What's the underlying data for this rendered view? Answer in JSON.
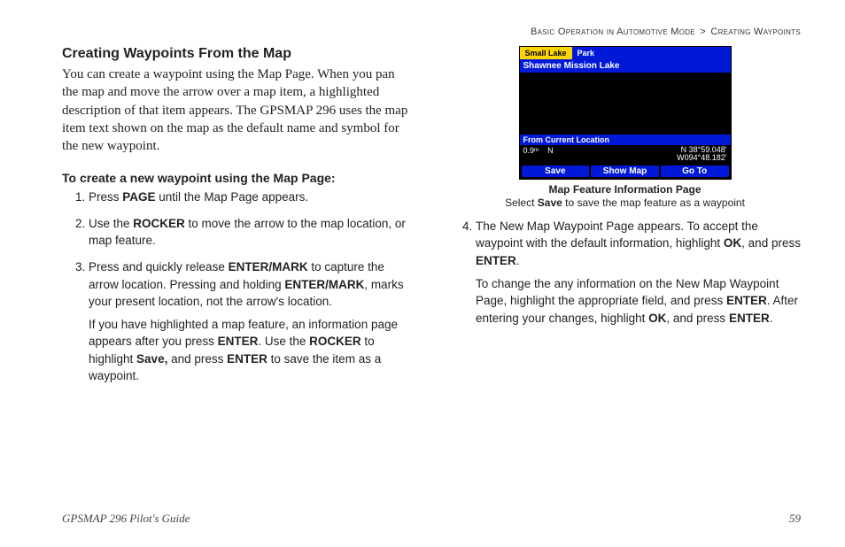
{
  "breadcrumb": {
    "section": "Basic Operation in Automotive Mode",
    "sep": ">",
    "sub": "Creating Waypoints"
  },
  "left": {
    "title": "Creating Waypoints From the Map",
    "intro": "You can create a waypoint using the Map Page. When you pan the map and move the arrow over a map item, a highlighted description of that item appears. The GPSMAP 296 uses the map item text shown on the map as the default name and symbol for the new waypoint.",
    "subhead": "To create a new waypoint using the Map Page:",
    "steps": {
      "s1_a": "Press ",
      "s1_b": "PAGE",
      "s1_c": " until the Map Page appears.",
      "s2_a": "Use the ",
      "s2_b": "ROCKER",
      "s2_c": " to move the arrow to the map location, or map feature.",
      "s3_a": "Press and quickly release ",
      "s3_b": "ENTER/MARK",
      "s3_c": " to capture the arrow location. Pressing and holding ",
      "s3_d": "ENTER/MARK",
      "s3_e": ", marks your present location, not the arrow's location.",
      "s3n_a": "If you have highlighted a map feature, an information page appears after you press ",
      "s3n_b": "ENTER",
      "s3n_c": ". Use the ",
      "s3n_d": "ROCKER",
      "s3n_e": " to highlight ",
      "s3n_f": "Save,",
      "s3n_g": " and press ",
      "s3n_h": "ENTER",
      "s3n_i": " to save the item as a waypoint."
    }
  },
  "right": {
    "device": {
      "tab_active": "Small Lake",
      "tab_inactive": "Park",
      "title": "Shawnee Mission Lake",
      "subtitle": "From Current Location",
      "dist": "0.9ᵐ",
      "dir": "N",
      "coord1": "N  38°59.048'",
      "coord2": "W094°48.182'",
      "btn1": "Save",
      "btn2": "Show Map",
      "btn3": "Go To"
    },
    "fig_caption": "Map Feature Information Page",
    "fig_sub_a": "Select ",
    "fig_sub_b": "Save",
    "fig_sub_c": " to save the map feature as a waypoint",
    "steps": {
      "s4_a": "The New Map Waypoint Page appears. To accept the waypoint with the default information, highlight ",
      "s4_b": "OK",
      "s4_c": ", and press ",
      "s4_d": "ENTER",
      "s4_e": ".",
      "s4n_a": "To change the any information on the New Map Waypoint Page, highlight the appropriate field, and press ",
      "s4n_b": "ENTER",
      "s4n_c": ". After entering your changes, highlight ",
      "s4n_d": "OK",
      "s4n_e": ", and press ",
      "s4n_f": "ENTER",
      "s4n_g": "."
    }
  },
  "footer": {
    "guide": "GPSMAP 296 Pilot's Guide",
    "page": "59"
  }
}
